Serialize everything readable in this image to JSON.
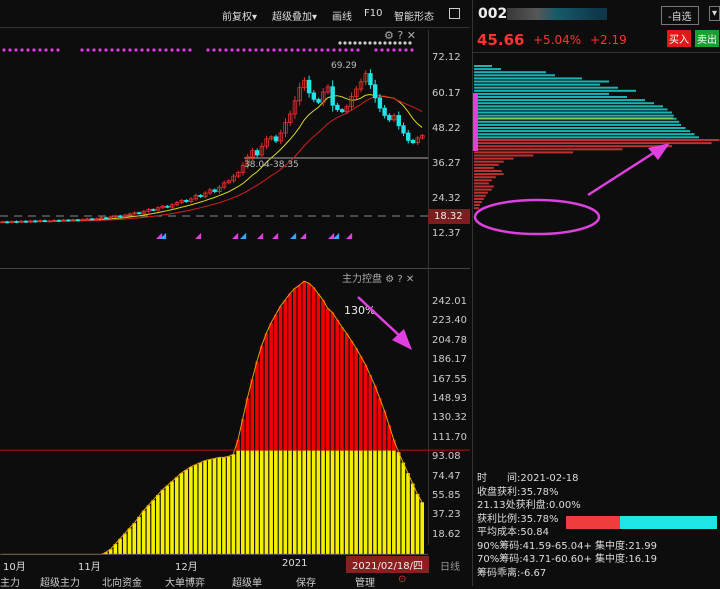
{
  "toolbar": {
    "fuquan": "前复权▾",
    "overlay": "超级叠加▾",
    "draw": "画线",
    "f10": "F10",
    "pattern": "智能形态"
  },
  "stock": {
    "code": "002",
    "price": "45.66",
    "pct": "+5.04%",
    "change": "+2.19",
    "watchlist": "-自选",
    "buy": "买入",
    "sell": "卖出"
  },
  "price_chart": {
    "high_label": "69.29",
    "gap_label": "38.04-38.35",
    "current_marker": "18.32",
    "axis": [
      "72.12",
      "60.17",
      "48.22",
      "36.27",
      "24.32",
      "12.37"
    ]
  },
  "indicator": {
    "title": "主力控盘",
    "annotation": "130%",
    "threshold": 100,
    "axis": [
      "242.01",
      "223.40",
      "204.78",
      "186.17",
      "167.55",
      "148.93",
      "130.32",
      "111.70",
      "93.08",
      "74.47",
      "55.85",
      "37.23",
      "18.62"
    ]
  },
  "dates": {
    "labels": [
      "10月",
      "11月",
      "12月",
      "2021"
    ],
    "selected": "2021/02/18/四",
    "period": "日线"
  },
  "tabs": [
    "主力",
    "超级主力",
    "北向资金",
    "大单博弈",
    "超级单",
    "保存",
    "管理"
  ],
  "chip_info": {
    "time": "时　　间:2021-02-18",
    "close_profit": "收盘获利:35.78%",
    "profit_at": "21.13处获利盘:0.00%",
    "profit_ratio": "获利比例:35.78%",
    "profit_ratio_value": 35.78,
    "avg_cost": "平均成本:50.84",
    "c90": "90%筹码:41.59-65.04+ 集中度:21.99",
    "c70": "70%筹码:43.71-60.60+ 集中度:16.19",
    "deviation": "筹码乖离:-6.67"
  },
  "colors": {
    "up": "#e8302e",
    "down": "#1ee6e6",
    "ma1": "#d8d820",
    "ma2": "#d02020",
    "accent": "#e040e0"
  },
  "chart_data": {
    "type": "candlestick",
    "closes": [
      16.2,
      16.0,
      16.3,
      16.1,
      16.4,
      16.2,
      16.5,
      16.3,
      16.6,
      16.4,
      16.5,
      16.7,
      16.6,
      16.8,
      16.7,
      16.9,
      16.8,
      17.0,
      17.2,
      17.1,
      17.3,
      17.6,
      17.5,
      17.9,
      18.2,
      18.0,
      18.5,
      18.9,
      19.3,
      19.1,
      19.8,
      20.4,
      20.2,
      21.0,
      21.5,
      21.2,
      22.0,
      22.8,
      23.5,
      23.1,
      24.0,
      25.2,
      24.8,
      26.0,
      27.1,
      26.5,
      28.0,
      29.5,
      30.2,
      31.8,
      33.0,
      35.5,
      38.3,
      40.5,
      39.0,
      42.0,
      44.5,
      45.2,
      43.8,
      46.5,
      50.1,
      53.0,
      57.5,
      62.0,
      64.5,
      60.2,
      58.0,
      57.0,
      60.5,
      62.3,
      56.0,
      54.5,
      53.8,
      55.5,
      59.0,
      61.5,
      64.0,
      66.8,
      63.0,
      58.5,
      55.0,
      52.5,
      51.0,
      52.5,
      49.0,
      46.5,
      44.0,
      43.2,
      44.8,
      45.66
    ],
    "control": [
      0,
      0,
      0,
      0,
      0,
      0,
      0,
      0,
      0,
      0,
      0,
      0,
      0,
      0,
      0,
      0,
      0,
      0,
      0,
      0,
      0,
      0,
      2,
      5,
      10,
      15,
      20,
      25,
      30,
      36,
      42,
      47,
      52,
      57,
      62,
      66,
      70,
      74,
      78,
      81,
      84,
      86,
      88,
      90,
      91,
      92,
      93,
      93,
      94,
      96,
      110,
      130,
      150,
      168,
      185,
      200,
      212,
      222,
      230,
      238,
      244,
      250,
      255,
      258,
      262,
      260,
      256,
      250,
      244,
      236,
      232,
      225,
      218,
      212,
      205,
      198,
      190,
      182,
      172,
      162,
      150,
      138,
      124,
      110,
      98,
      88,
      78,
      68,
      58,
      50
    ],
    "chips_upper": [
      20,
      30,
      80,
      90,
      120,
      150,
      140,
      160,
      180,
      150,
      170,
      190,
      200,
      210,
      215,
      220,
      222,
      225,
      228,
      230,
      235,
      240,
      245,
      250
    ],
    "chips_lower": [
      248,
      240,
      200,
      150,
      100,
      60,
      40,
      30,
      25,
      20,
      28,
      30,
      22,
      18,
      15,
      20,
      18,
      14,
      12,
      10,
      8,
      6,
      5
    ]
  }
}
